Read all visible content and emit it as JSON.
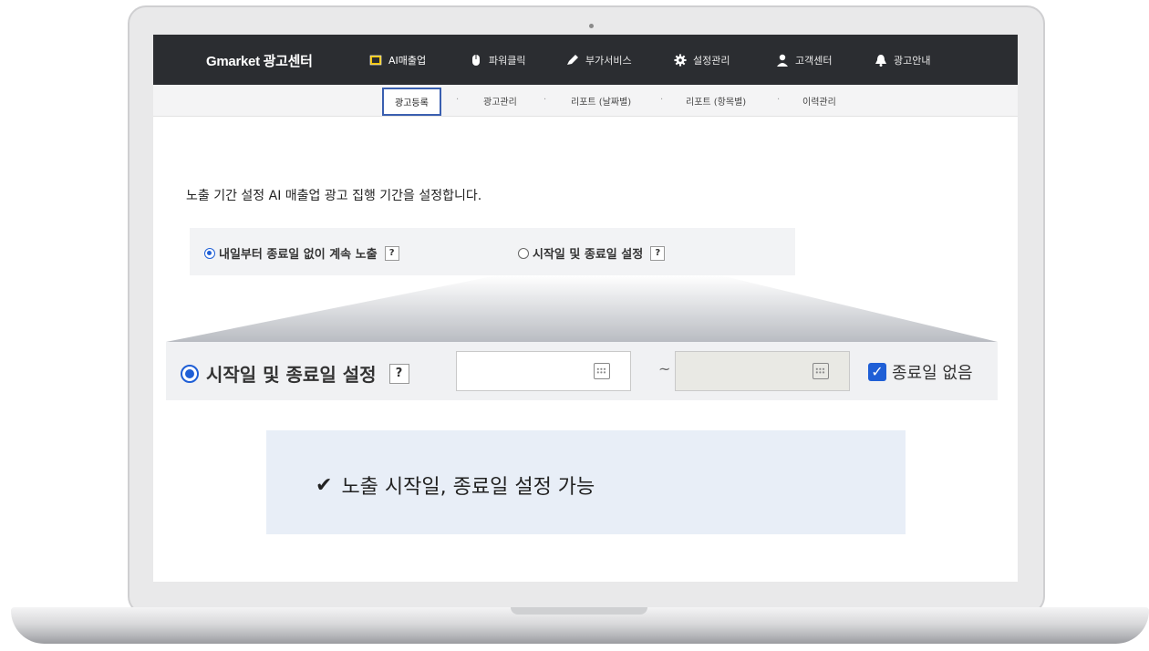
{
  "nav": {
    "logo": "Gmarket 광고센터",
    "items": [
      {
        "label": "AI매출업",
        "icon": "ai-chip-icon",
        "active": true
      },
      {
        "label": "파워클릭",
        "icon": "mouse-icon",
        "active": false
      },
      {
        "label": "부가서비스",
        "icon": "pen-icon",
        "active": false
      },
      {
        "label": "설정관리",
        "icon": "gear-icon",
        "active": false
      },
      {
        "label": "고객센터",
        "icon": "person-icon",
        "active": false
      },
      {
        "label": "광고안내",
        "icon": "bell-icon",
        "active": false
      }
    ]
  },
  "subnav": {
    "items": [
      "광고등록",
      "광고관리",
      "리포트 (날짜별)",
      "리포트 (항목별)",
      "이력관리"
    ],
    "active_index": 0
  },
  "content": {
    "description": "노출 기간 설정 AI 매출업 광고 집행 기간을 설정합니다.",
    "options": [
      {
        "label": "내일부터 종료일 없이 계속 노출",
        "selected": true
      },
      {
        "label": "시작일 및 종료일 설정",
        "selected": false
      }
    ],
    "help_label": "?"
  },
  "zoom": {
    "option_label": "시작일 및 종료일 설정",
    "help_label": "?",
    "start_date": "",
    "end_date": "",
    "range_separator": "~",
    "no_end_date_label": "종료일 없음",
    "no_end_date_checked": true,
    "check_mark": "✓"
  },
  "info": {
    "check_symbol": "✔",
    "text": "노출 시작일, 종료일 설정 가능"
  },
  "colors": {
    "nav_bg": "#2b2d31",
    "accent": "#1f5fd6",
    "info_bg": "#e8eef7"
  }
}
